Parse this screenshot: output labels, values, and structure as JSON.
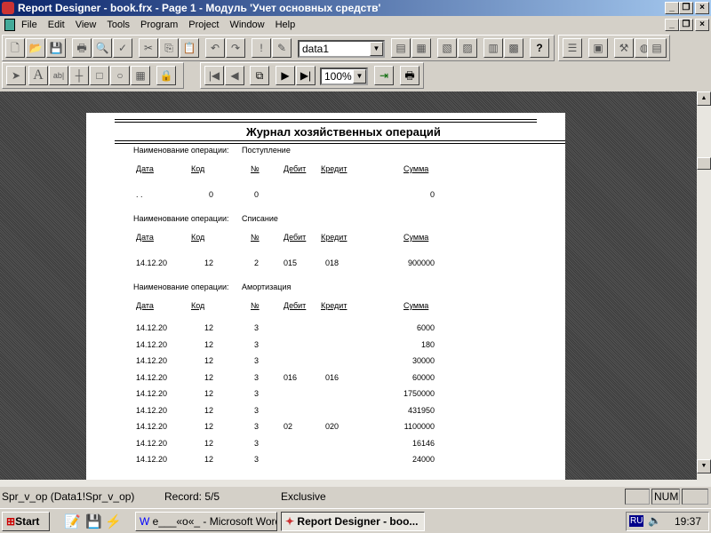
{
  "window": {
    "title": "Report Designer - book.frx - Page 1 - Модуль 'Учет основных средств'"
  },
  "menu": [
    "File",
    "Edit",
    "View",
    "Tools",
    "Program",
    "Project",
    "Window",
    "Help"
  ],
  "toolbar": {
    "datasource": "data1",
    "zoom": "100%"
  },
  "report": {
    "title": "Журнал хозяйственных операций",
    "op_label": "Наименование операции:",
    "headers": {
      "date": "Дата",
      "code": "Код",
      "num": "№",
      "debit": "Дебит",
      "credit": "Кредит",
      "sum": "Сумма"
    },
    "groups": [
      {
        "name": "Поступление",
        "rows": [
          {
            "date": ". .",
            "code": "0",
            "num": "0",
            "debit": "",
            "credit": "",
            "sum": "0"
          }
        ]
      },
      {
        "name": "Списание",
        "rows": [
          {
            "date": "14.12.20",
            "code": "12",
            "num": "2",
            "debit": "015",
            "credit": "018",
            "sum": "900000"
          }
        ]
      },
      {
        "name": "Амортизация",
        "rows": [
          {
            "date": "14.12.20",
            "code": "12",
            "num": "3",
            "debit": "",
            "credit": "",
            "sum": "6000"
          },
          {
            "date": "14.12.20",
            "code": "12",
            "num": "3",
            "debit": "",
            "credit": "",
            "sum": "180"
          },
          {
            "date": "14.12.20",
            "code": "12",
            "num": "3",
            "debit": "",
            "credit": "",
            "sum": "30000"
          },
          {
            "date": "14.12.20",
            "code": "12",
            "num": "3",
            "debit": "016",
            "credit": "016",
            "sum": "60000"
          },
          {
            "date": "14.12.20",
            "code": "12",
            "num": "3",
            "debit": "",
            "credit": "",
            "sum": "1750000"
          },
          {
            "date": "14.12.20",
            "code": "12",
            "num": "3",
            "debit": "",
            "credit": "",
            "sum": "431950"
          },
          {
            "date": "14.12.20",
            "code": "12",
            "num": "3",
            "debit": "02",
            "credit": "020",
            "sum": "1100000"
          },
          {
            "date": "14.12.20",
            "code": "12",
            "num": "3",
            "debit": "",
            "credit": "",
            "sum": "16146"
          },
          {
            "date": "14.12.20",
            "code": "12",
            "num": "3",
            "debit": "",
            "credit": "",
            "sum": "24000"
          }
        ]
      }
    ]
  },
  "status": {
    "alias": "Spr_v_op (Data1!Spr_v_op)",
    "record": "Record: 5/5",
    "mode": "Exclusive",
    "num": "NUM"
  },
  "taskbar": {
    "start": "Start",
    "tasks": [
      "е___«о«_ - Microsoft Word",
      "Report Designer - boo..."
    ],
    "lang": "RU",
    "time": "19:37"
  }
}
